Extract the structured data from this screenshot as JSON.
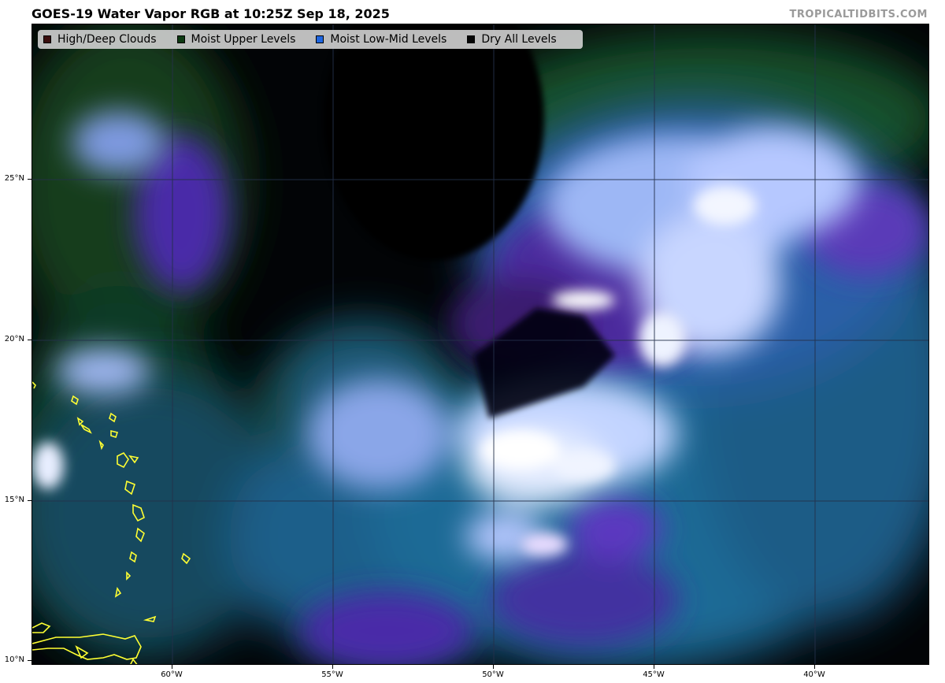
{
  "header": {
    "title": "GOES-19 Water Vapor RGB at 10:25Z Sep 18, 2025",
    "brand": "TROPICALTIDBITS.COM"
  },
  "legend": {
    "items": [
      {
        "label": "High/Deep Clouds",
        "color": "#3a0e0e"
      },
      {
        "label": "Moist Upper Levels",
        "color": "#0d3a12"
      },
      {
        "label": "Moist Low-Mid Levels",
        "color": "#1f66e0"
      },
      {
        "label": "Dry All Levels",
        "color": "#050505"
      }
    ]
  },
  "axes": {
    "lat_labels": [
      "25°N",
      "20°N",
      "15°N",
      "10°N"
    ],
    "lon_labels": [
      "60°W",
      "55°W",
      "50°W",
      "45°W",
      "40°W"
    ]
  },
  "colors": {
    "ocean_dry": "#020406",
    "moist_low_mid": "#1f5f8e",
    "moist_upper": "#123d1c",
    "high_cloud": "#c8d8ff",
    "purple": "#5a2fb8",
    "coastline": "#ffff33",
    "gridline": "#24304a"
  }
}
